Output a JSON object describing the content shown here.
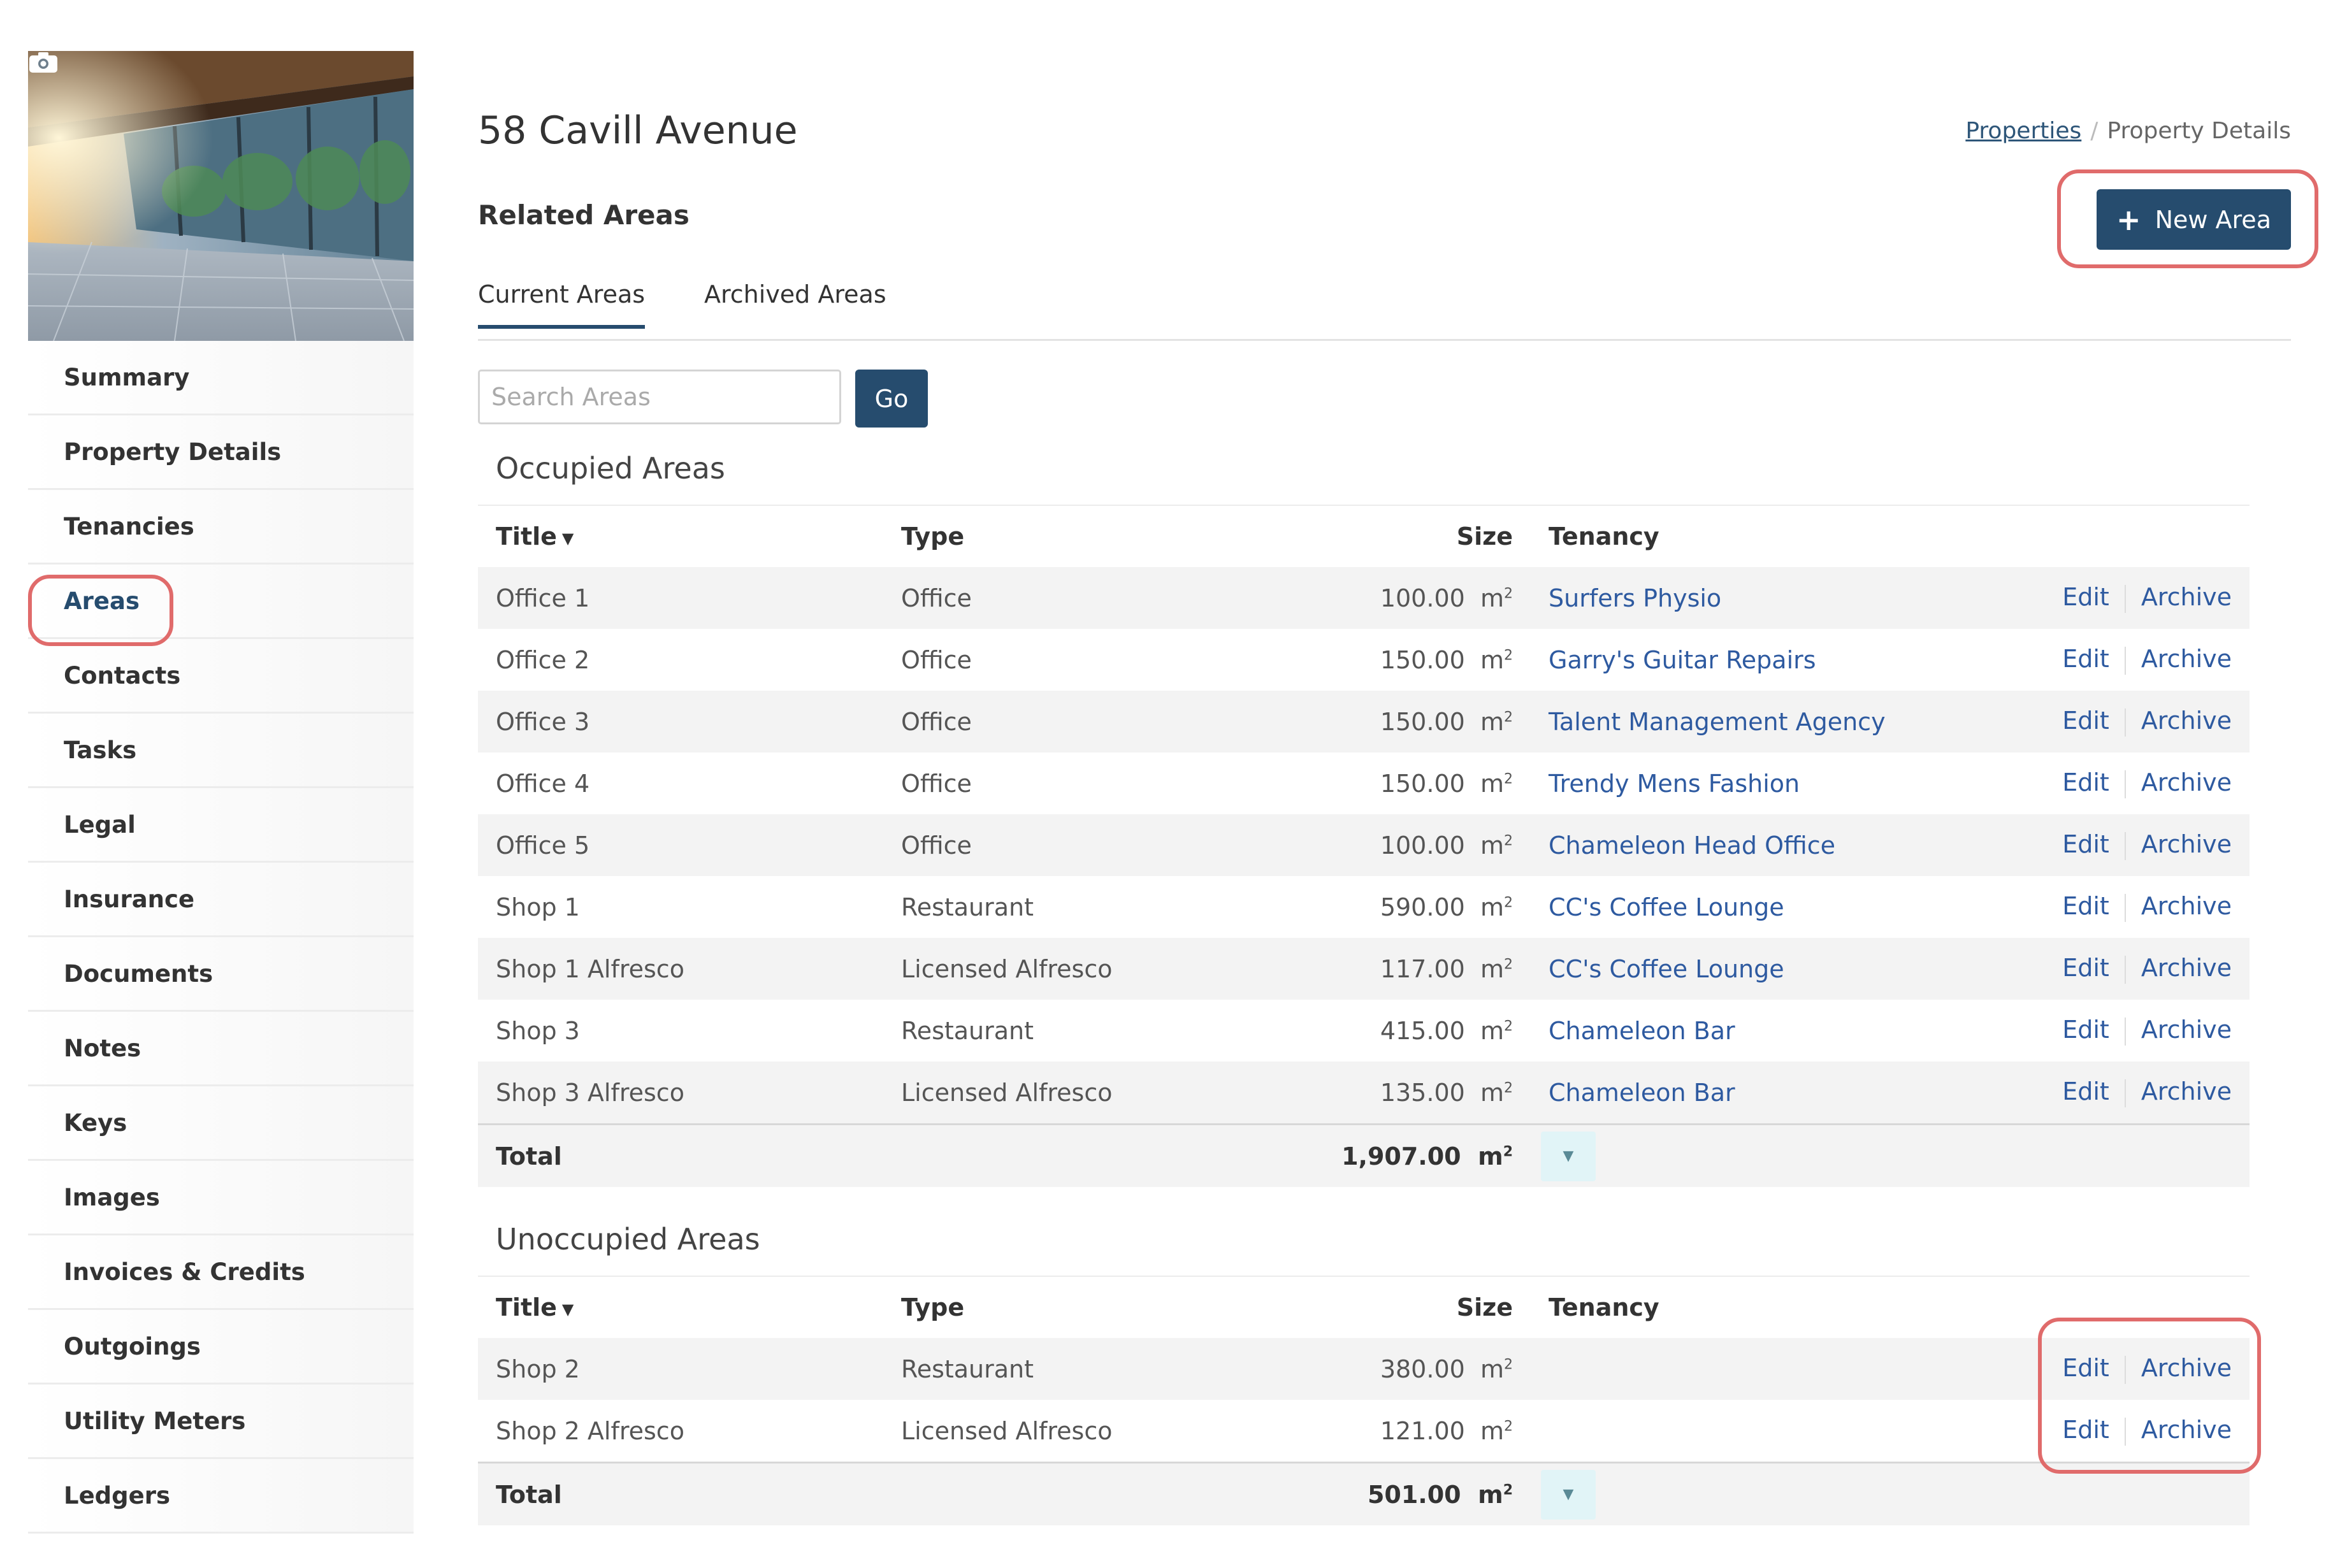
{
  "page": {
    "title": "58 Cavill Avenue"
  },
  "breadcrumb": {
    "link": "Properties",
    "separator": "/",
    "current": "Property Details"
  },
  "section": {
    "title": "Related Areas",
    "new_area_label": "New Area",
    "new_area_icon": "plus-icon"
  },
  "tabs": [
    {
      "label": "Current Areas",
      "active": true
    },
    {
      "label": "Archived Areas",
      "active": false
    }
  ],
  "search": {
    "placeholder": "Search Areas",
    "value": "",
    "go_label": "Go"
  },
  "sidebar": {
    "photo_icon": "camera-icon",
    "items": [
      {
        "label": "Summary"
      },
      {
        "label": "Property Details"
      },
      {
        "label": "Tenancies"
      },
      {
        "label": "Areas",
        "active": true
      },
      {
        "label": "Contacts"
      },
      {
        "label": "Tasks"
      },
      {
        "label": "Legal"
      },
      {
        "label": "Insurance"
      },
      {
        "label": "Documents"
      },
      {
        "label": "Notes"
      },
      {
        "label": "Keys"
      },
      {
        "label": "Images"
      },
      {
        "label": "Invoices & Credits"
      },
      {
        "label": "Outgoings"
      },
      {
        "label": "Utility Meters"
      },
      {
        "label": "Ledgers"
      }
    ]
  },
  "columns": {
    "title": "Title",
    "type": "Type",
    "size": "Size",
    "tenancy": "Tenancy"
  },
  "actions": {
    "edit": "Edit",
    "archive": "Archive"
  },
  "unit": {
    "base": "m",
    "sup": "2"
  },
  "occupied": {
    "heading": "Occupied Areas",
    "rows": [
      {
        "title": "Office 1",
        "type": "Office",
        "size": "100.00",
        "tenancy": "Surfers Physio"
      },
      {
        "title": "Office 2",
        "type": "Office",
        "size": "150.00",
        "tenancy": "Garry's Guitar Repairs"
      },
      {
        "title": "Office 3",
        "type": "Office",
        "size": "150.00",
        "tenancy": "Talent Management Agency"
      },
      {
        "title": "Office 4",
        "type": "Office",
        "size": "150.00",
        "tenancy": "Trendy Mens Fashion"
      },
      {
        "title": "Office 5",
        "type": "Office",
        "size": "100.00",
        "tenancy": "Chameleon Head Office"
      },
      {
        "title": "Shop 1",
        "type": "Restaurant",
        "size": "590.00",
        "tenancy": "CC's Coffee Lounge"
      },
      {
        "title": "Shop 1 Alfresco",
        "type": "Licensed Alfresco",
        "size": "117.00",
        "tenancy": "CC's Coffee Lounge"
      },
      {
        "title": "Shop 3",
        "type": "Restaurant",
        "size": "415.00",
        "tenancy": "Chameleon Bar"
      },
      {
        "title": "Shop 3 Alfresco",
        "type": "Licensed Alfresco",
        "size": "135.00",
        "tenancy": "Chameleon Bar"
      }
    ],
    "total_label": "Total",
    "total": "1,907.00"
  },
  "unoccupied": {
    "heading": "Unoccupied Areas",
    "rows": [
      {
        "title": "Shop 2",
        "type": "Restaurant",
        "size": "380.00",
        "tenancy": ""
      },
      {
        "title": "Shop 2 Alfresco",
        "type": "Licensed Alfresco",
        "size": "121.00",
        "tenancy": ""
      }
    ],
    "total_label": "Total",
    "total": "501.00"
  },
  "colors": {
    "primary": "#264c6e",
    "link": "#2e5aa0",
    "highlight": "#e06b6b",
    "expand_bg": "#e1f4f7"
  }
}
